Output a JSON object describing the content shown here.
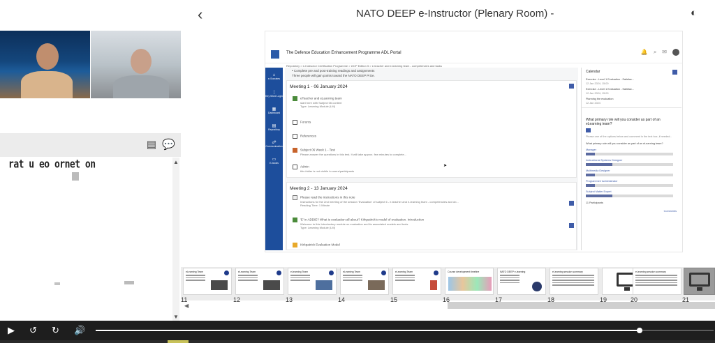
{
  "header": {
    "back_icon": "chevron-left-icon",
    "title": "NATO DEEP e-Instructor (Plenary Room) -",
    "theme_icon": "moon-icon"
  },
  "left_panel": {
    "notes_text": "rat u  eo   ornet on",
    "panel_icons": [
      "notes-icon",
      "chat-icon"
    ]
  },
  "slide": {
    "portal_title": "The Defence Education Enhancement Programme ADL Portal",
    "breadcrumb": "Repository  >  e-Instructor Certification Programme  >  eICP Edition 5  >  e-teacher and e-learning team - competencies and tasks",
    "intro_lines": [
      "• Complete pre and post-training readings and assignments",
      "Three people will gain points toward the NATO DEEP Prize."
    ],
    "nav": [
      {
        "icon": "home-icon",
        "label": "e-Socrates"
      },
      {
        "icon": "dots-icon",
        "label": "Key Word Login"
      },
      {
        "icon": "dashboard-icon",
        "label": "Dashboard"
      },
      {
        "icon": "repository-icon",
        "label": "Repository"
      },
      {
        "icon": "community-icon",
        "label": "Communication"
      },
      {
        "icon": "ebooks-icon",
        "label": "E-books"
      }
    ],
    "meeting1": {
      "title": "Meeting 1 - 06 January 2024",
      "items": [
        {
          "title": "eTeacher and eLearning team",
          "line2": "start here with Subject 06 content",
          "line3": "Type: Learning Module (LM)"
        },
        {
          "title": "Forums",
          "line2": "",
          "line3": ""
        },
        {
          "title": "References",
          "line2": "",
          "line3": ""
        },
        {
          "title": "Subject 06 Week 1 - Test",
          "line2": "Please answer the questions in this test. It will take approx. few minutes to complete...",
          "line3": ""
        },
        {
          "title": "Admin",
          "line2": "this folder is not visible to users/participants",
          "line3": ""
        }
      ]
    },
    "meeting2": {
      "title": "Meeting 2 - 13 January 2024",
      "items": [
        {
          "title": "Please read the instructions in this note",
          "line2": "Instructions for the 2nd meeting of the session 'Evaluation' of subject 6 - e-teacher and e-learning team - competencies and ob...",
          "line3": "Reading Time: 1 Minute"
        },
        {
          "title": "'E' in ADDIE? What is evaluation all about? Kirkpatrick's model of evaluation. Introduction",
          "line2": "Welcome to this Introductory module on evaluation and its associated models and tools.",
          "line3": "Type: Learning Module (LM)"
        },
        {
          "title": "Kirkpatrick Evaluation Model",
          "line2": "",
          "line3": ""
        }
      ]
    },
    "calendar": {
      "title": "Calendar",
      "events": [
        {
          "name": "Exercise - Level 1 Evaluation - Satisfac...",
          "date": "12 Jan 2024, 15:00"
        },
        {
          "name": "Exercise - Level 1 Evaluation - Satisfac...",
          "date": "12 Jan 2024, 15:00"
        },
        {
          "name": "Planning the evaluation",
          "date": "12 Jan 2024"
        }
      ]
    },
    "poll": {
      "question": "What primary role will you consider as part of an eLearning team?",
      "hint": "Please one of the options below and comment in the text box, if needed...",
      "sub": "What primary role will you consider as part of an eLearning team?",
      "options": [
        {
          "label": "Manager",
          "value": 0.1
        },
        {
          "label": "Instructional Systems Designer",
          "value": 0.3
        },
        {
          "label": "Multimedia Designer",
          "value": 0.1
        },
        {
          "label": "Programmer/ Administrator",
          "value": 0.1
        },
        {
          "label": "Subject Matter Expert",
          "value": 0.3
        }
      ],
      "participants": "11 Participants",
      "comments": "Comments"
    }
  },
  "thumbnails": [
    {
      "num": "11",
      "title": "eLearning Team",
      "kind": "content"
    },
    {
      "num": "12",
      "title": "eLearning Team",
      "kind": "content"
    },
    {
      "num": "13",
      "title": "eLearning Team",
      "kind": "content"
    },
    {
      "num": "14",
      "title": "eLearning Team",
      "kind": "content"
    },
    {
      "num": "15",
      "title": "eLearning Team",
      "kind": "content"
    },
    {
      "num": "16",
      "title": "Course development timeline",
      "kind": "content"
    },
    {
      "num": "17",
      "title": "NATO DEEP e-learning",
      "kind": "content"
    },
    {
      "num": "18",
      "title": "eLearning session summary",
      "kind": "content"
    },
    {
      "num": "19",
      "title": "",
      "kind": "placeholder"
    },
    {
      "num": "20",
      "title": "eLearning session summary",
      "kind": "content"
    },
    {
      "num": "21",
      "title": "",
      "kind": "active"
    }
  ],
  "player": {
    "play_icon": "play-icon",
    "rewind_icon": "rewind-icon",
    "forward_icon": "forward-icon",
    "volume_icon": "volume-icon",
    "progress": 0.88
  }
}
